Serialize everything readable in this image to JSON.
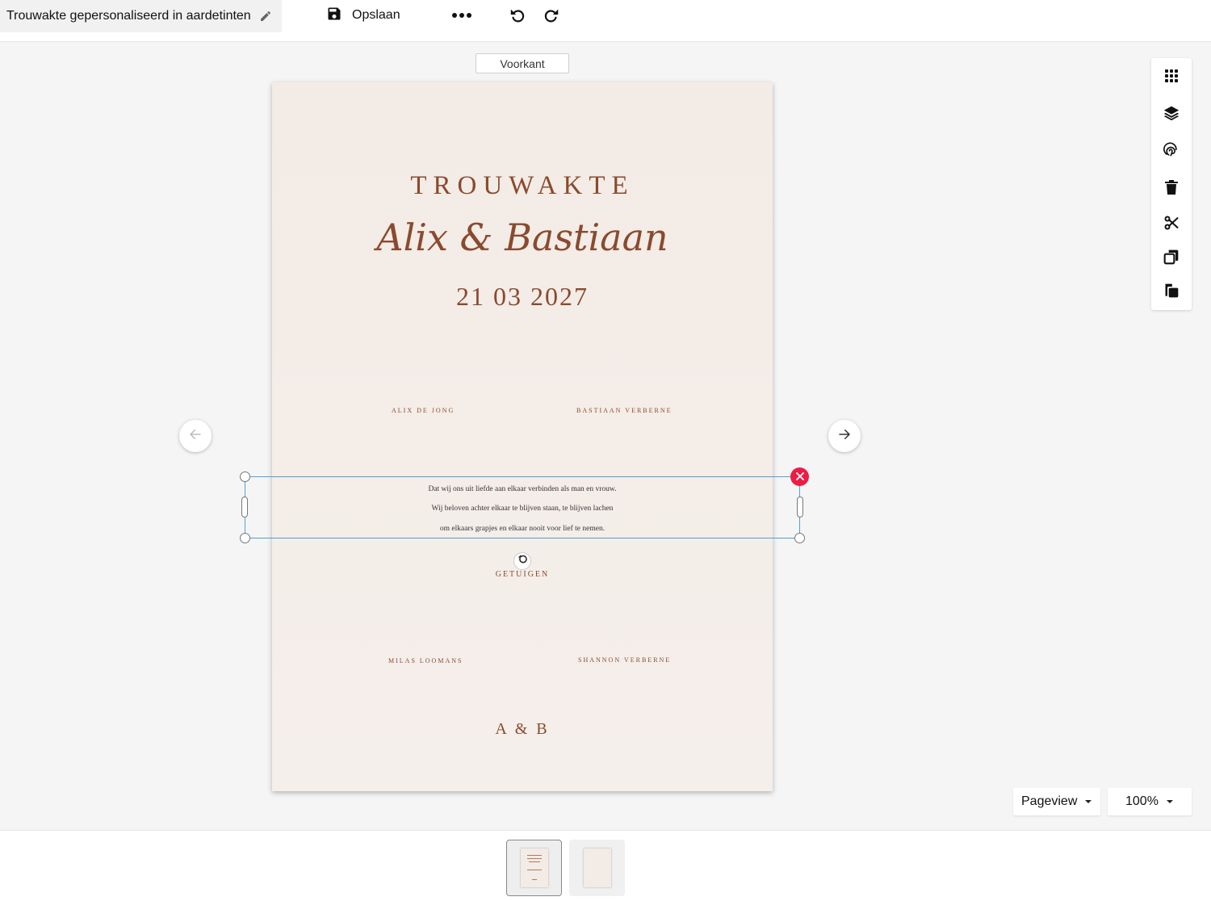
{
  "header": {
    "document_title": "Trouwakte gepersonaliseerd in aardetinten",
    "save_label": "Opslaan"
  },
  "canvas": {
    "side_label": "Voorkant",
    "card": {
      "title": "TROUWAKTE",
      "names_script": "Alix & Bastiaan",
      "date": "21 03 2027",
      "name_1": "ALIX DE JONG",
      "name_2": "BASTIAAN VERBERNE",
      "vow_lines": [
        "Dat wij ons uit liefde aan elkaar verbinden als man en vrouw.",
        "Wij beloven achter elkaar te blijven staan, te blijven lachen",
        "om elkaars grapjes en elkaar nooit voor lief te nemen."
      ],
      "witnesses_heading": "GETUIGEN",
      "witness_1": "MILAS LOOMANS",
      "witness_2": "SHANNON VERBERNE",
      "initials": "A & B"
    }
  },
  "toolbar": {
    "tools": [
      "grid-icon",
      "layers-icon",
      "fingerprint-icon",
      "trash-icon",
      "scissors-icon",
      "copy-icon",
      "paste-icon"
    ]
  },
  "view": {
    "mode": "Pageview",
    "zoom": "100%"
  },
  "colors": {
    "accent_text": "#8a4a2e",
    "card_bg": "#f3ebe5",
    "selection": "#4f9fd8",
    "delete": "#ed1c44"
  }
}
